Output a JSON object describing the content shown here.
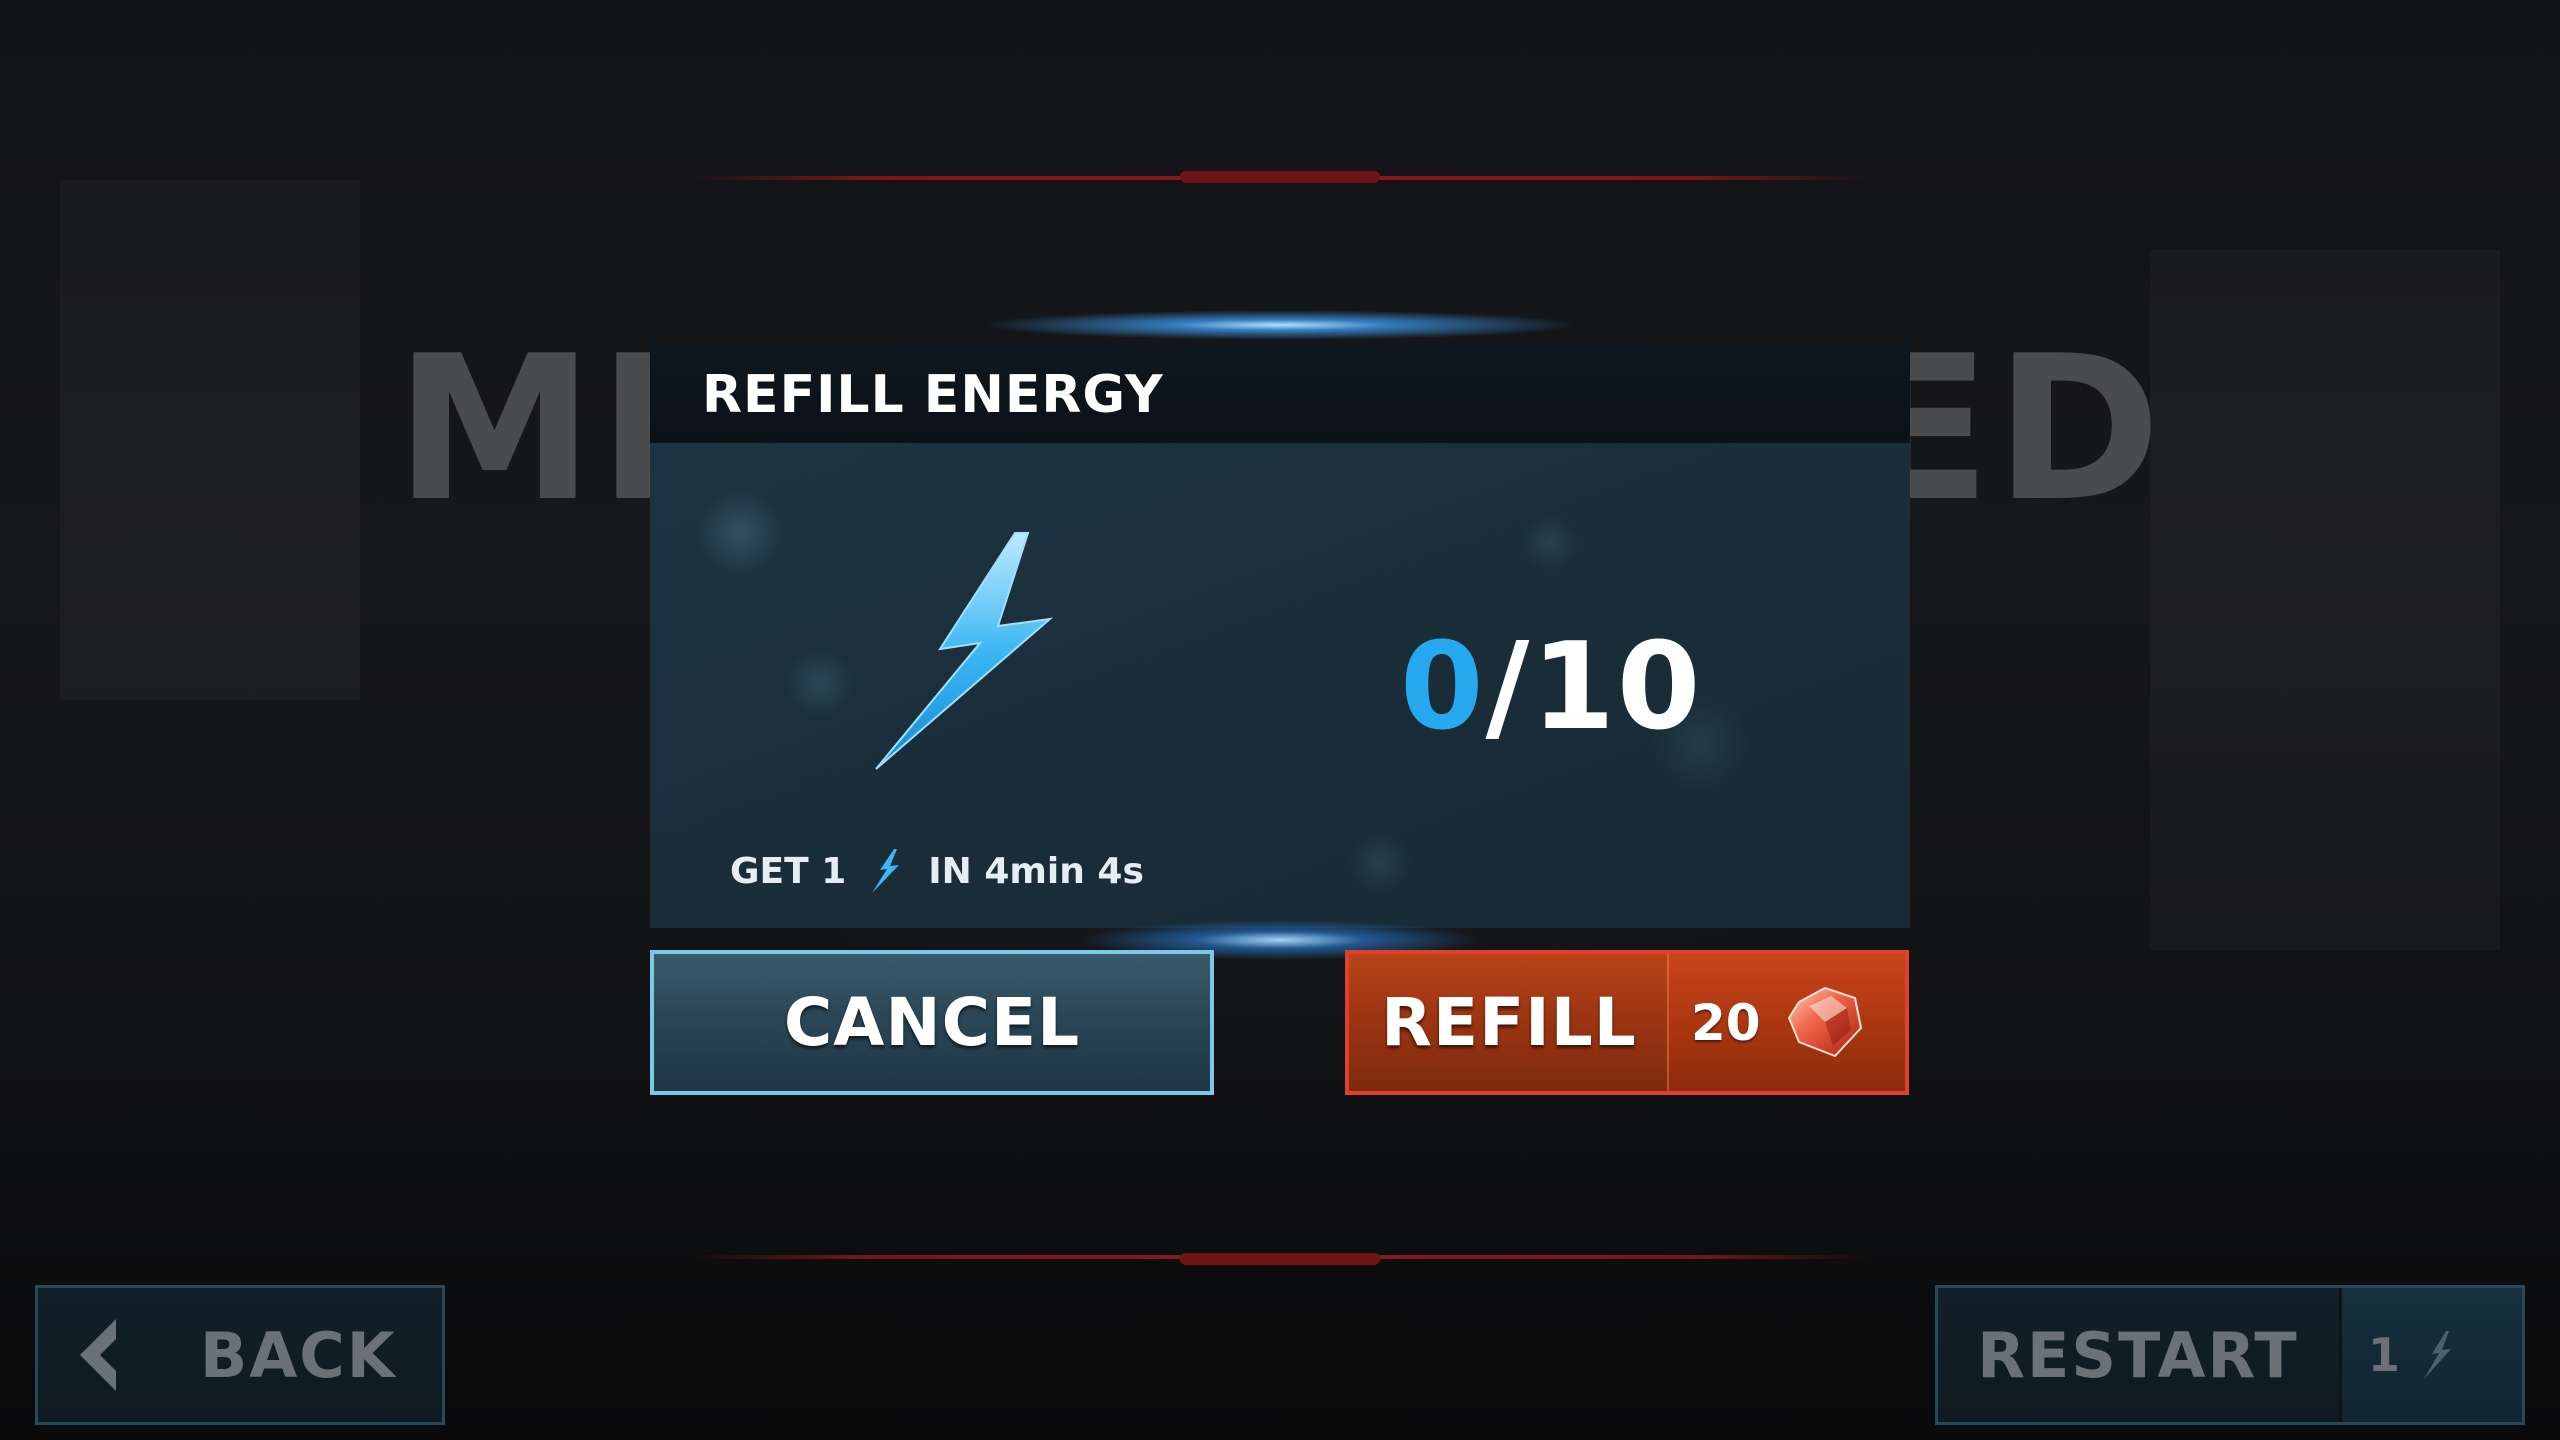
{
  "background": {
    "title_left": "MI",
    "title_right": "ED"
  },
  "dialog": {
    "title": "REFILL ENERGY",
    "energy": {
      "current": "0",
      "separator": "/",
      "max": "10",
      "current_color": "#27a9ef"
    },
    "timer": {
      "prefix": "GET 1",
      "suffix": "IN 4min 4s",
      "icon": "lightning-icon"
    },
    "cancel_label": "CANCEL",
    "refill_label": "REFILL",
    "refill_price": "20",
    "refill_currency_icon": "gem-icon"
  },
  "nav": {
    "back_label": "BACK",
    "back_icon": "chevron-left-icon",
    "restart_label": "RESTART",
    "restart_cost": "1",
    "restart_cost_icon": "lightning-icon"
  },
  "colors": {
    "accent_blue": "#27a9ef",
    "refill_orange": "#b84418",
    "cancel_border": "#7fc7e6",
    "refill_border": "#e2402e"
  }
}
